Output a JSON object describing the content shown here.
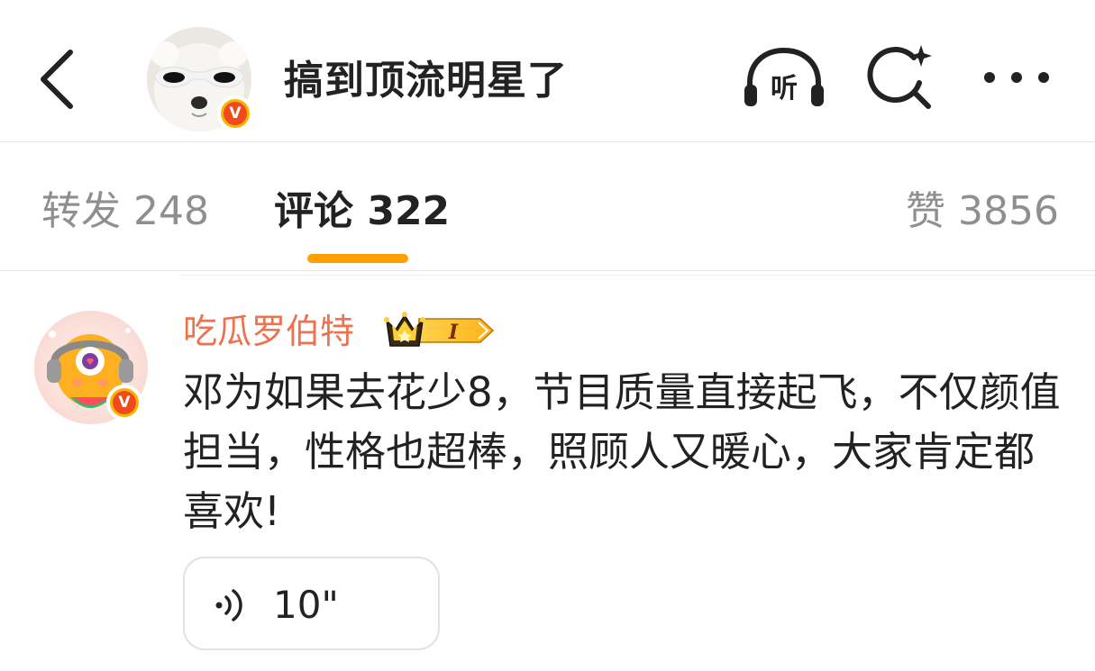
{
  "header": {
    "title": "搞到顶流明星了",
    "avatar_badge": "V",
    "listen_label": "听"
  },
  "tabs": {
    "repost_label": "转发",
    "repost_count": "248",
    "comment_label": "评论",
    "comment_count": "322",
    "like_label": "赞",
    "like_count": "3856"
  },
  "comment": {
    "username": "吃瓜罗伯特",
    "member_level": "I",
    "avatar_badge": "V",
    "text": "邓为如果去花少8，节目质量直接起飞，不仅颜值担当，性格也超棒，照顾人又暖心，大家肯定都喜欢!",
    "voice_duration": "10\""
  },
  "colors": {
    "accent": "#ff9f00",
    "username": "#eb7350",
    "verified_badge": "#f04a1a",
    "badge_ring": "#f7b500"
  },
  "icons": [
    "back-arrow-icon",
    "listen-headphones-icon",
    "search-sparkle-icon",
    "more-dots-icon",
    "verified-v-icon",
    "crown-icon",
    "voice-wave-icon"
  ]
}
